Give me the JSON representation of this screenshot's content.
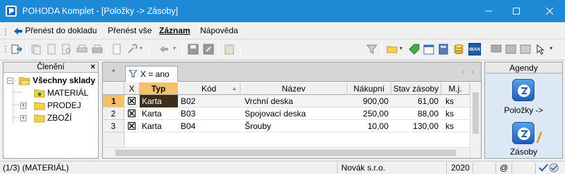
{
  "window": {
    "title": "POHODA Komplet - [Položky -> Zásoby]",
    "app_icon": "pohoda-logo-icon",
    "controls": [
      "minimize-icon",
      "maximize-icon",
      "close-icon"
    ]
  },
  "menu": {
    "transfer_label": "Přenést do dokladu",
    "transfer_all_label": "Přenést vše",
    "record_label": "Záznam",
    "help_label": "Nápověda"
  },
  "toolbar": {
    "combo_value": "",
    "ibans_label": "IBAN"
  },
  "left_panel": {
    "title": "Členění",
    "close_glyph": "×",
    "tree": [
      {
        "label": "Všechny sklady",
        "expander": "−"
      },
      {
        "label": "MATERIÁL",
        "expander": ""
      },
      {
        "label": "PRODEJ",
        "expander": "+"
      },
      {
        "label": "ZBOŽÍ",
        "expander": "+"
      }
    ]
  },
  "filter": {
    "star": "*",
    "tab_label": "X = ano",
    "nav_prev": "‹",
    "nav_next": "›"
  },
  "table": {
    "columns": [
      "X",
      "Typ",
      "Kód",
      "Název",
      "Nákupní",
      "Stav zásoby",
      "M.j."
    ],
    "rows": [
      {
        "num": "1",
        "checked": true,
        "typ": "Karta",
        "kod": "B02",
        "nazev": "Vrchní deska",
        "nakupni": "900,00",
        "stav": "61,00",
        "mj": "ks"
      },
      {
        "num": "2",
        "checked": true,
        "typ": "Karta",
        "kod": "B03",
        "nazev": "Spojovací deska",
        "nakupni": "250,00",
        "stav": "88,00",
        "mj": "ks"
      },
      {
        "num": "3",
        "checked": true,
        "typ": "Karta",
        "kod": "B04",
        "nazev": "Šrouby",
        "nakupni": "10,00",
        "stav": "130,00",
        "mj": "ks"
      }
    ],
    "sort_glyph": "▲",
    "selected_header_color": "#f5c26b",
    "selected_cell_color": "#3c2e1a"
  },
  "agendy": {
    "title": "Agendy",
    "items": [
      {
        "label": "Položky ->",
        "icon": "pohoda-agenda-icon"
      },
      {
        "label": "Zásoby",
        "icon": "pohoda-agenda-edit-icon"
      }
    ]
  },
  "status": {
    "position": "(1/3) (MATERIÁL)",
    "company": "Novák s.r.o.",
    "year": "2020",
    "at": "@"
  },
  "colors": {
    "titlebar": "#1e8ad6",
    "agendy_bg": "#dce8f5"
  }
}
